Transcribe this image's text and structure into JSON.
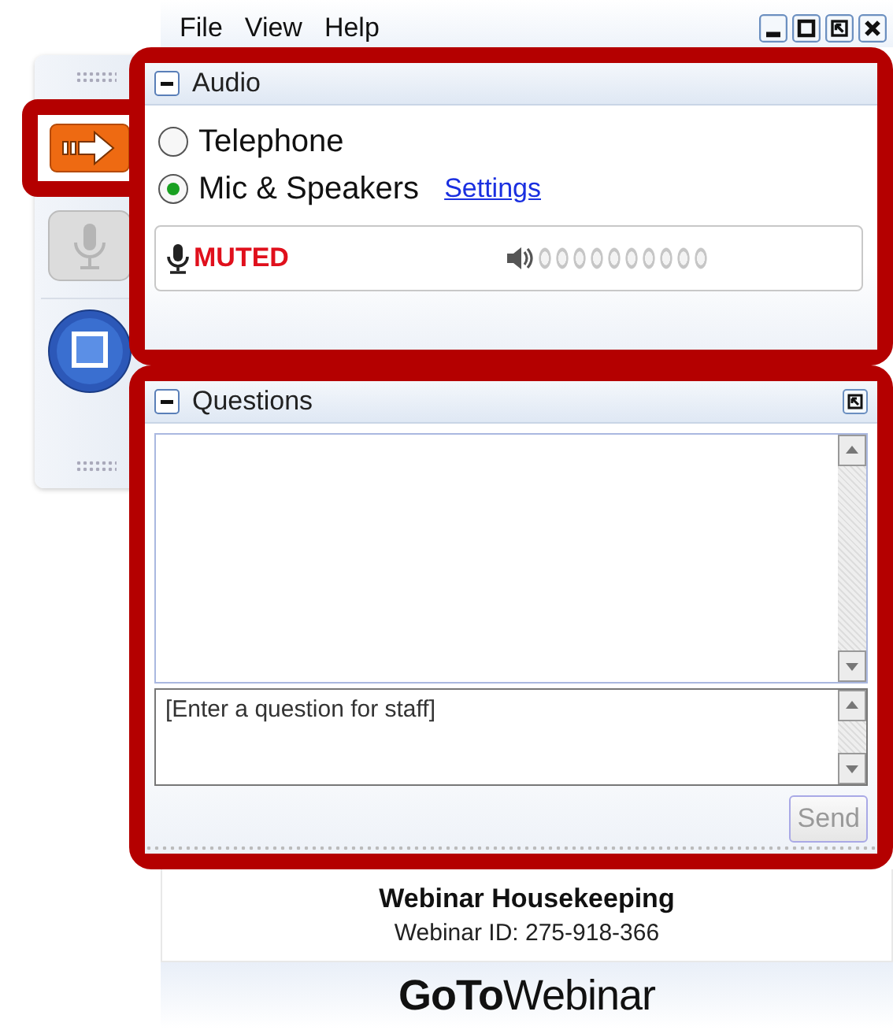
{
  "menu": [
    "File",
    "View",
    "Help"
  ],
  "window_controls": [
    {
      "kind": "minimize"
    },
    {
      "kind": "maximize"
    },
    {
      "kind": "restore"
    },
    {
      "kind": "close"
    }
  ],
  "toolbar": [
    {
      "kind": "arrow",
      "highlighted": true,
      "disabled": false
    },
    {
      "kind": "mic",
      "highlighted": false,
      "disabled": true
    },
    {
      "kind": "screen",
      "highlighted": false,
      "disabled": false
    }
  ],
  "audio": {
    "title": "Audio",
    "expanded": true,
    "highlighted": true,
    "options": [
      {
        "label": "Telephone",
        "selected": false
      },
      {
        "label": "Mic & Speakers",
        "selected": true
      }
    ],
    "settings_link": "Settings",
    "status": "MUTED",
    "level": 0
  },
  "questions": {
    "title": "Questions",
    "expanded": true,
    "highlighted": true,
    "placeholder": "[Enter a question for staff]",
    "send": {
      "label": "Send",
      "disabled": true
    }
  },
  "footer": {
    "title": "Webinar Housekeeping",
    "webinar_id": "Webinar ID: 275-918-366",
    "logo": "**GoTo**Webinar"
  }
}
